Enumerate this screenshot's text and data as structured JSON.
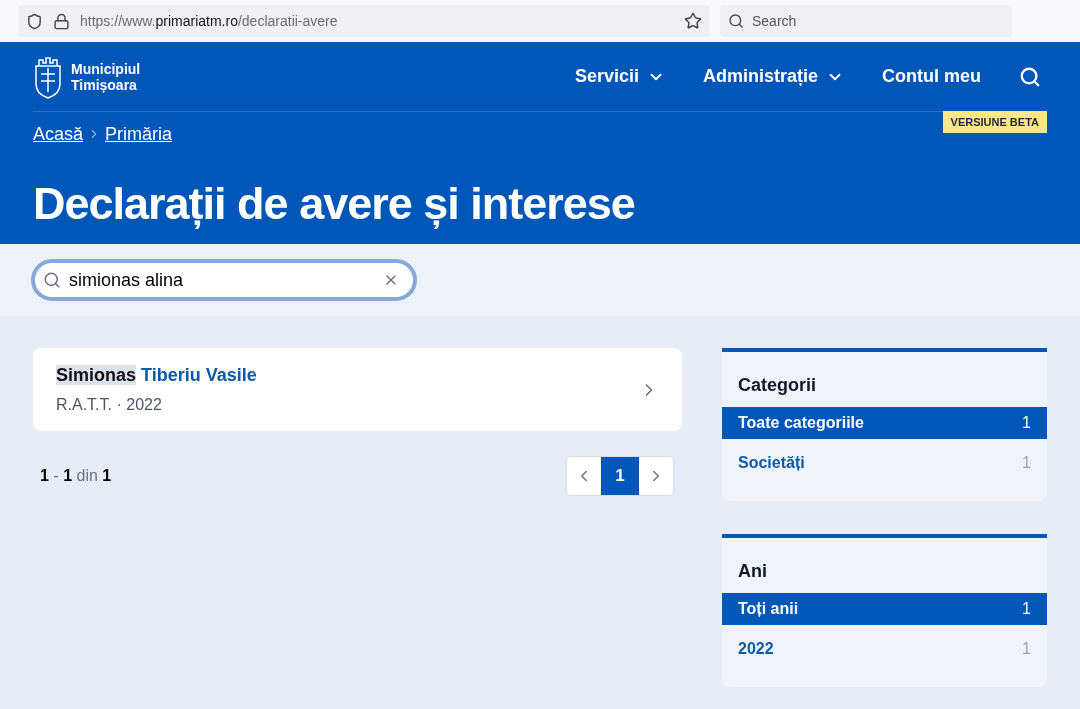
{
  "browser": {
    "url_parts": [
      {
        "text": "https://www.",
        "strong": false
      },
      {
        "text": "primariatm.ro",
        "strong": true
      },
      {
        "text": "/declaratii-avere",
        "strong": false
      }
    ],
    "search_placeholder": "Search"
  },
  "header": {
    "logo_lines": [
      "Municipiul",
      "Timișoara"
    ],
    "nav": [
      {
        "label": "Servicii",
        "dropdown": true
      },
      {
        "label": "Administrație",
        "dropdown": true
      },
      {
        "label": "Contul meu",
        "dropdown": false
      }
    ],
    "breadcrumbs": [
      "Acasă",
      "Primăria"
    ],
    "badge": "VERSIUNE BETA",
    "title": "Declarații de avere și interese"
  },
  "search": {
    "value": "simionas alina"
  },
  "results": [
    {
      "name_parts": [
        {
          "text": "Simionas",
          "highlighted": true
        },
        {
          "text": "Tiberiu Vasile",
          "highlighted": false
        }
      ],
      "meta": "R.A.T.T. · 2022"
    }
  ],
  "count": "**1** - **1** din **1**",
  "pagination": {
    "pages": [
      {
        "label": "1",
        "selected": true
      }
    ]
  },
  "filters": [
    {
      "title": "Categorii",
      "items": [
        {
          "label": "Toate categoriile",
          "count": "1",
          "selected": true
        },
        {
          "label": "Societăți",
          "count": "1",
          "selected": false
        }
      ]
    },
    {
      "title": "Ani",
      "items": [
        {
          "label": "Toți anii",
          "count": "1",
          "selected": true
        },
        {
          "label": "2022",
          "count": "1",
          "selected": false
        }
      ]
    }
  ]
}
